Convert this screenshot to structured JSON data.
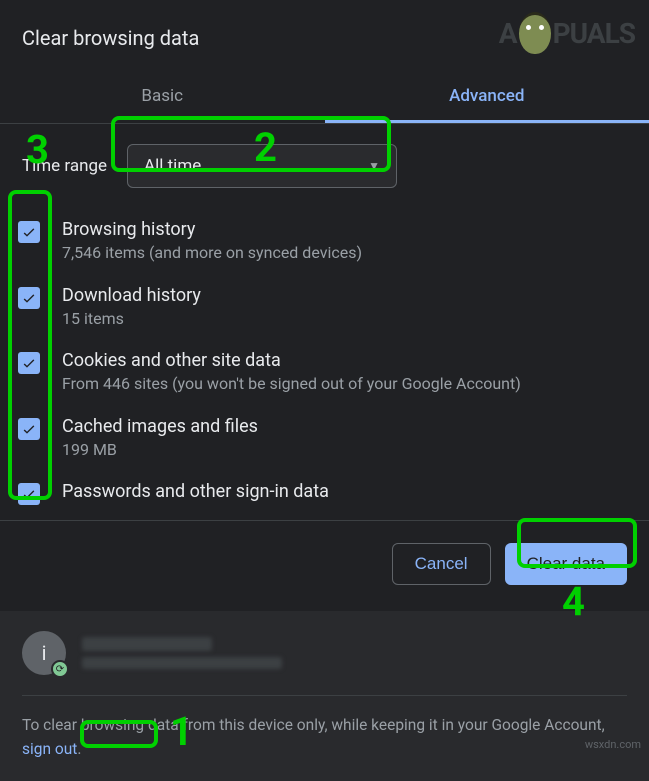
{
  "dialog_title": "Clear browsing data",
  "tabs": {
    "basic": "Basic",
    "advanced": "Advanced"
  },
  "time_range": {
    "label": "Time range",
    "selected": "All time"
  },
  "options": [
    {
      "title": "Browsing history",
      "sub": "7,546 items (and more on synced devices)",
      "checked": true
    },
    {
      "title": "Download history",
      "sub": "15 items",
      "checked": true
    },
    {
      "title": "Cookies and other site data",
      "sub": "From 446 sites (you won't be signed out of your Google Account)",
      "checked": true
    },
    {
      "title": "Cached images and files",
      "sub": "199 MB",
      "checked": true
    },
    {
      "title": "Passwords and other sign-in data",
      "sub": "",
      "checked": true
    }
  ],
  "buttons": {
    "cancel": "Cancel",
    "clear": "Clear data"
  },
  "account": {
    "avatar_letter": "i"
  },
  "footer": {
    "text_before": "To clear browsing data from this device only, while keeping it in your Google Account, ",
    "link": "sign out",
    "text_after": "."
  },
  "annotations": {
    "n1": "1",
    "n2": "2",
    "n3": "3",
    "n4": "4"
  },
  "watermark": {
    "left": "A",
    "right": "PUALS"
  },
  "attribution": "wsxdn.com"
}
